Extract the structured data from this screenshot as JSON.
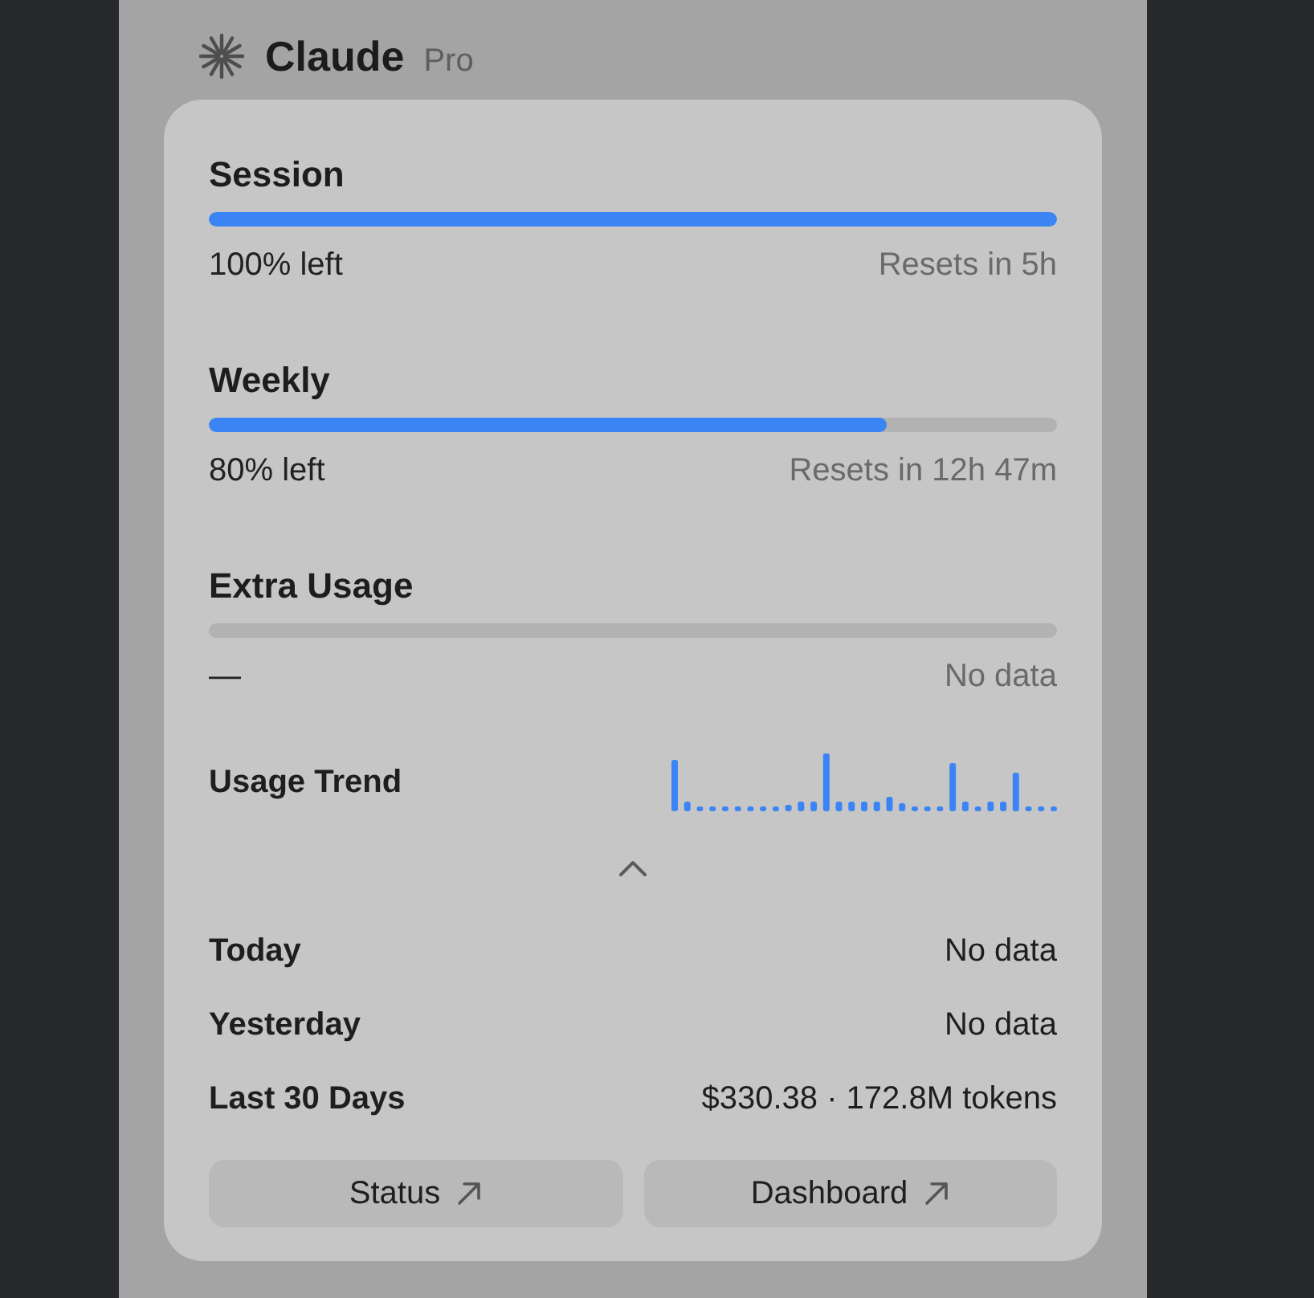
{
  "header": {
    "title": "Claude",
    "plan": "Pro"
  },
  "meters": [
    {
      "title": "Session",
      "level": 1,
      "left": "100% left",
      "reset": "Resets in 5h"
    },
    {
      "title": "Weekly",
      "level": 0.8,
      "left": "80% left",
      "reset": "Resets in 12h 47m"
    },
    {
      "title": "Extra Usage",
      "left": "—",
      "reset": "No data"
    }
  ],
  "trend": {
    "label": "Usage Trend"
  },
  "details": {
    "expanded": true,
    "rows": [
      {
        "label": "Today",
        "value": "No data"
      },
      {
        "label": "Yesterday",
        "value": "No data"
      },
      {
        "label": "Last 30 Days",
        "value": "$330.38 · 172.8M tokens"
      }
    ]
  },
  "buttons": [
    {
      "label": "Status"
    },
    {
      "label": "Dashboard"
    }
  ]
}
